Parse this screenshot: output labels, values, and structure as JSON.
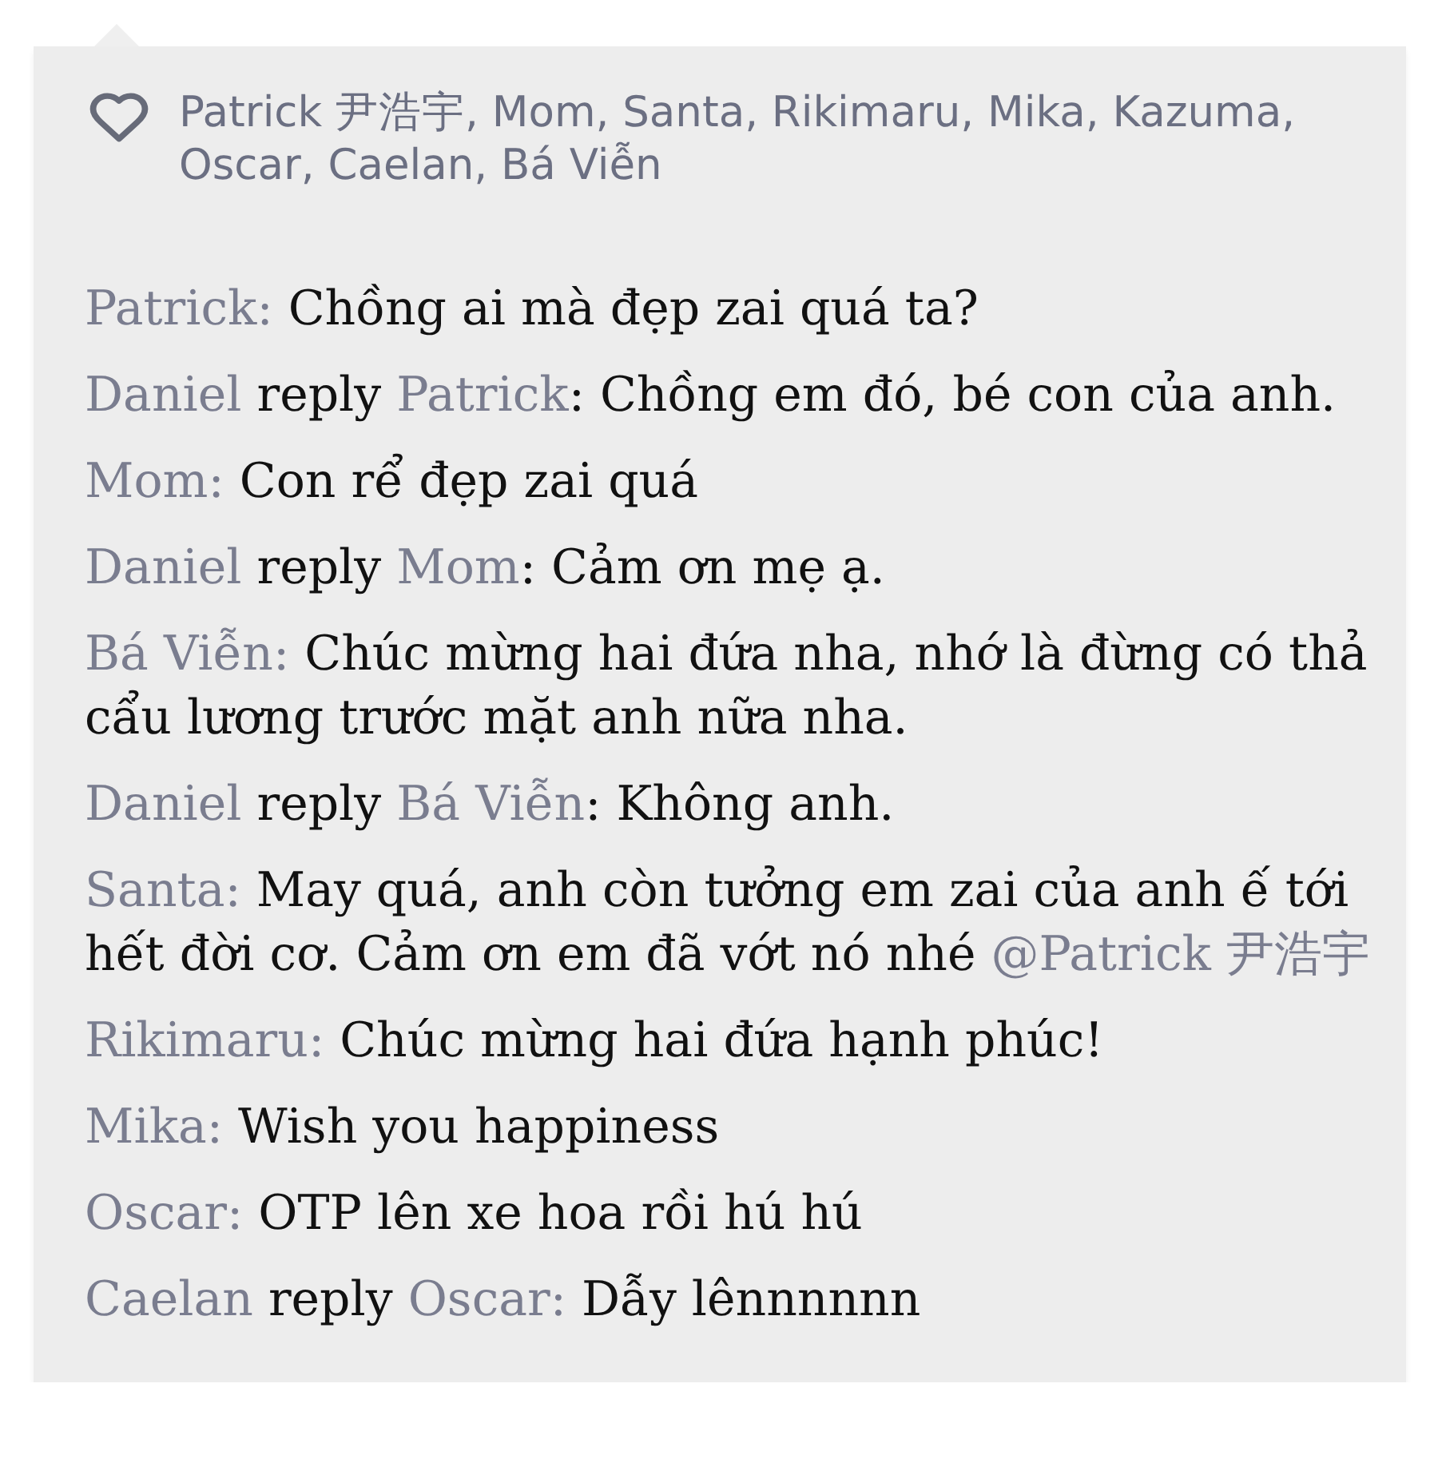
{
  "likes": {
    "names": "Patrick 尹浩宇, Mom, Santa, Rikimaru, Mika, Kazuma, Oscar, Caelan, Bá Viễn"
  },
  "comments": [
    {
      "parts": [
        {
          "kind": "name",
          "text": "Patrick:"
        },
        {
          "kind": "plain",
          "text": " Chồng ai mà đẹp zai quá ta?"
        }
      ]
    },
    {
      "parts": [
        {
          "kind": "name",
          "text": "Daniel"
        },
        {
          "kind": "plain",
          "text": " reply "
        },
        {
          "kind": "name",
          "text": "Patrick"
        },
        {
          "kind": "plain",
          "text": ": Chồng em đó, bé con của anh."
        }
      ]
    },
    {
      "parts": [
        {
          "kind": "name",
          "text": "Mom:"
        },
        {
          "kind": "plain",
          "text": " Con rể đẹp zai quá"
        }
      ]
    },
    {
      "parts": [
        {
          "kind": "name",
          "text": "Daniel"
        },
        {
          "kind": "plain",
          "text": " reply "
        },
        {
          "kind": "name",
          "text": "Mom"
        },
        {
          "kind": "plain",
          "text": ": Cảm ơn mẹ ạ."
        }
      ]
    },
    {
      "parts": [
        {
          "kind": "name",
          "text": "Bá Viễn:"
        },
        {
          "kind": "plain",
          "text": " Chúc mừng hai đứa nha, nhớ là đừng có thả cẩu lương trước mặt anh nữa nha."
        }
      ]
    },
    {
      "parts": [
        {
          "kind": "name",
          "text": "Daniel"
        },
        {
          "kind": "plain",
          "text": " reply "
        },
        {
          "kind": "name",
          "text": "Bá Viễn"
        },
        {
          "kind": "plain",
          "text": ": Không anh."
        }
      ]
    },
    {
      "parts": [
        {
          "kind": "name",
          "text": "Santa:"
        },
        {
          "kind": "plain",
          "text": " May quá, anh còn tưởng em zai của anh ế tới hết đời cơ. Cảm ơn em đã vớt nó nhé "
        },
        {
          "kind": "mention",
          "text": "@Patrick 尹浩宇"
        }
      ]
    },
    {
      "parts": [
        {
          "kind": "name",
          "text": "Rikimaru:"
        },
        {
          "kind": "plain",
          "text": " Chúc mừng hai đứa hạnh phúc!"
        }
      ]
    },
    {
      "parts": [
        {
          "kind": "name",
          "text": "Mika:"
        },
        {
          "kind": "plain",
          "text": " Wish you happiness"
        }
      ]
    },
    {
      "parts": [
        {
          "kind": "name",
          "text": "Oscar:"
        },
        {
          "kind": "plain",
          "text": " OTP lên xe hoa rồi hú hú"
        }
      ]
    },
    {
      "parts": [
        {
          "kind": "name",
          "text": "Caelan"
        },
        {
          "kind": "plain",
          "text": " reply "
        },
        {
          "kind": "name",
          "text": "Oscar:"
        },
        {
          "kind": "plain",
          "text": " Dẫy lênnnnnn"
        }
      ]
    }
  ]
}
